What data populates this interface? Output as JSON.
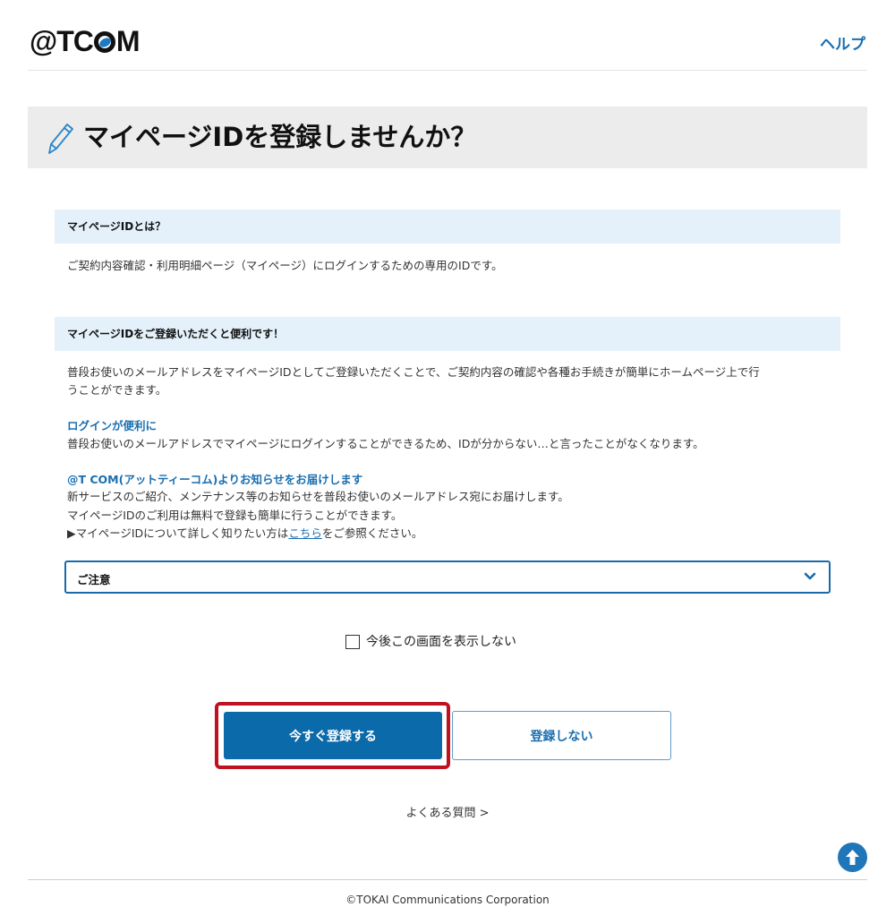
{
  "header": {
    "logo_part1": "@T",
    "logo_part2": "C",
    "logo_part3": "M",
    "help_label": "ヘルプ"
  },
  "page": {
    "title": "マイページIDを登録しませんか？"
  },
  "sections": {
    "what_is": {
      "heading": "マイページIDとは？",
      "body": "ご契約内容確認・利用明細ページ（マイページ）にログインするための専用のIDです。"
    },
    "benefits": {
      "heading": "マイページIDをご登録いただくと便利です！",
      "intro_line1": "普段お使いのメールアドレスをマイページIDとしてご登録いただくことで、ご契約内容の確認や各種お手続きが簡単にホームページ上で行",
      "intro_line2": "うことができます。",
      "login_title": "ログインが便利に",
      "login_body": "普段お使いのメールアドレスでマイページにログインすることができるため、IDが分からない…と言ったことがなくなります。",
      "notice_title": "@T COM(アットティーコム)よりお知らせをお届けします",
      "notice_line1": "新サービスのご紹介、メンテナンス等のお知らせを普段お使いのメールアドレス宛にお届けします。",
      "notice_line2": "マイページIDのご利用は無料で登録も簡単に行うことができます。",
      "notice_line3_pre": "▶マイページIDについて詳しく知りたい方は",
      "notice_line3_link": "こちら",
      "notice_line3_post": "をご参照ください。"
    }
  },
  "caution": {
    "label": "ご注意"
  },
  "checkbox": {
    "label": "今後この画面を表示しない",
    "checked": false
  },
  "buttons": {
    "register_now": "今すぐ登録する",
    "dont_register": "登録しない"
  },
  "faq": {
    "label": "よくある質問 >"
  },
  "footer": {
    "copyright": "©TOKAI Communications Corporation"
  },
  "colors": {
    "brand_blue": "#0b6aa9",
    "link_blue": "#1a6fb0",
    "highlight_red": "#c0121e",
    "section_bg": "#e4f1fa",
    "title_band_bg": "#ececec"
  }
}
